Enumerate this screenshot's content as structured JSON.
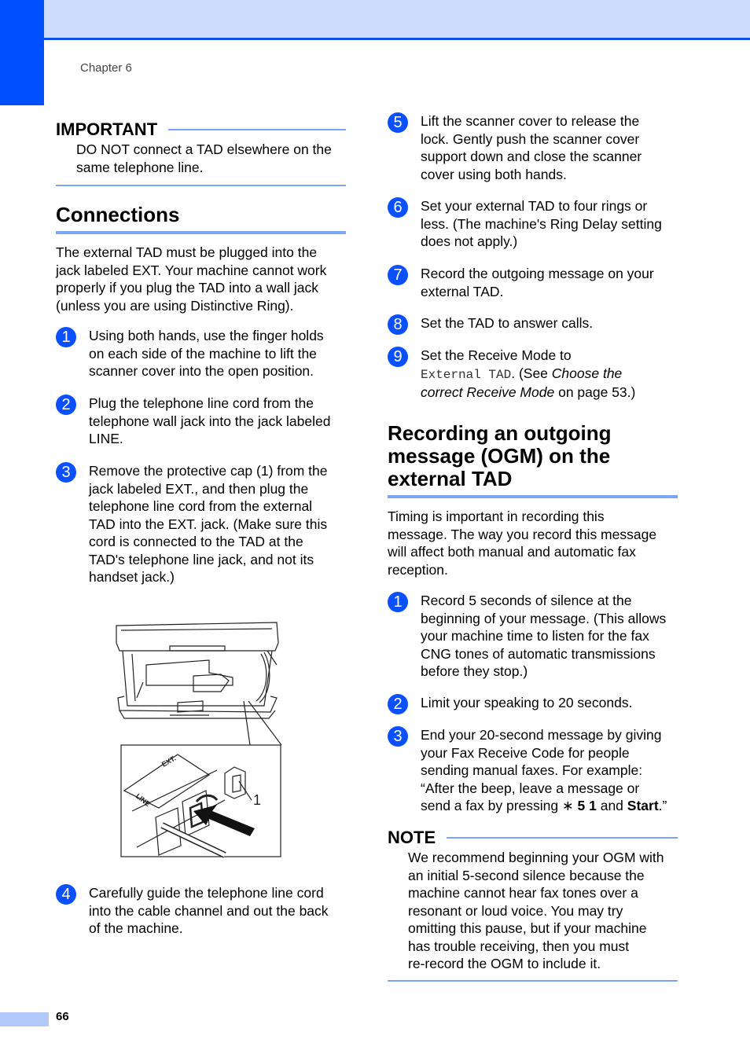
{
  "header": {
    "chapter": "Chapter 6",
    "colors": {
      "band": "#cddcfc",
      "rule": "#0a50e6",
      "side_tab": "#0050ff",
      "accent_rule": "#7ba4f4",
      "badge": "#0a50ff"
    }
  },
  "important": {
    "title": "IMPORTANT",
    "text_line1": "DO NOT connect a TAD elsewhere on the",
    "text_line2": "same telephone line."
  },
  "connections": {
    "title": "Connections",
    "intro": [
      "The external TAD must be plugged into the",
      "jack labeled EXT. Your machine cannot work",
      "properly if you plug the TAD into a wall jack",
      "(unless you are using Distinctive Ring)."
    ],
    "steps": [
      {
        "num": "1",
        "lines": [
          "Using both hands, use the finger holds",
          "on each side of the machine to lift the",
          "scanner cover into the open position."
        ]
      },
      {
        "num": "2",
        "lines": [
          "Plug the telephone line cord from the",
          "telephone wall jack into the jack labeled",
          "LINE."
        ]
      },
      {
        "num": "3",
        "lines": [
          "Remove the protective cap (1) from the",
          "jack labeled EXT., and then plug the",
          "telephone line cord from the external",
          "TAD into the EXT. jack. (Make sure this",
          "cord is connected to the TAD at the",
          "TAD's telephone line jack, and not its",
          "handset jack.)"
        ]
      },
      {
        "num": "4",
        "lines": [
          "Carefully guide the telephone line cord",
          "into the cable channel and out the back",
          "of the machine."
        ]
      },
      {
        "num": "5",
        "lines": [
          "Lift the scanner cover to release the",
          "lock. Gently push the scanner cover",
          "support down and close the scanner",
          "cover using both hands."
        ]
      },
      {
        "num": "6",
        "lines": [
          "Set your external TAD to four rings or",
          "less. (The machine's Ring Delay setting",
          "does not apply.)"
        ]
      },
      {
        "num": "7",
        "lines": [
          "Record the outgoing message on your",
          "external TAD."
        ]
      },
      {
        "num": "8",
        "lines": [
          "Set the TAD to answer calls."
        ]
      },
      {
        "num": "9",
        "line1": "Set the Receive Mode to",
        "mode": "External TAD",
        "see_prefix": ". (See ",
        "see_link": "Choose the",
        "see_link2": "correct Receive Mode",
        "see_suffix": " on page 53.)"
      }
    ],
    "illustration": {
      "labels": {
        "ext": "EXT.",
        "line": "LINE",
        "callout": "1"
      }
    }
  },
  "ogm": {
    "title_lines": [
      "Recording an outgoing",
      "message (OGM) on the",
      "external TAD"
    ],
    "intro": [
      "Timing is important in recording this",
      "message. The way you record this message",
      "will affect both manual and automatic fax",
      "reception."
    ],
    "steps": [
      {
        "num": "1",
        "lines": [
          "Record 5 seconds of silence at the",
          "beginning of your message. (This allows",
          "your machine time to listen for the fax",
          "CNG tones of automatic transmissions",
          "before they stop.)"
        ]
      },
      {
        "num": "2",
        "lines": [
          "Limit your speaking to 20 seconds."
        ]
      },
      {
        "num": "3",
        "lines": [
          "End your 20-second message by giving",
          "your Fax Receive Code for people",
          "sending manual faxes. For example:",
          "“After the beep, leave a message or"
        ],
        "last_prefix": "send a fax by pressing ",
        "star": "∗",
        "code": " 5 1",
        "and": " and ",
        "start": "Start",
        "end": ".”"
      }
    ]
  },
  "note": {
    "title": "NOTE",
    "lines": [
      "We recommend beginning your OGM with",
      "an initial 5-second silence because the",
      "machine cannot hear fax tones over a",
      "resonant or loud voice. You may try",
      "omitting this pause, but if your machine",
      "has trouble receiving, then you must",
      "re-record the OGM to include it."
    ]
  },
  "footer": {
    "page_number": "66"
  }
}
